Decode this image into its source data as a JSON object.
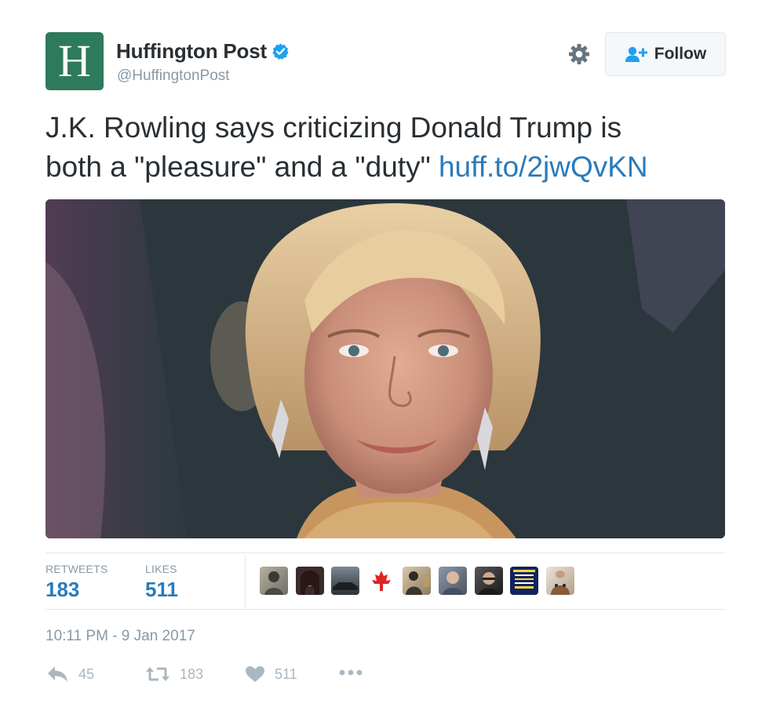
{
  "account": {
    "avatar_letter": "H",
    "display_name": "Huffington Post",
    "handle": "@HuffingtonPost",
    "verified": true,
    "brand_color": "#2d7a5c"
  },
  "header": {
    "follow_label": "Follow",
    "settings_icon": "gear-icon",
    "follow_icon": "add-user-icon"
  },
  "tweet": {
    "text_line1": "J.K. Rowling says criticizing Donald Trump is",
    "text_line2": "both a \"pleasure\" and a \"duty\"",
    "link": "huff.to/2jwQvKN",
    "link_color": "#2b7bb9"
  },
  "stats": {
    "retweets_label": "RETWEETS",
    "retweets_count": "183",
    "likes_label": "LIKES",
    "likes_count": "511",
    "liker_avatars": [
      "avatar-1",
      "avatar-2",
      "avatar-3",
      "avatar-canada-flag",
      "avatar-5",
      "avatar-6",
      "avatar-7",
      "avatar-8",
      "avatar-9"
    ]
  },
  "meta": {
    "timestamp": "10:11 PM - 9 Jan 2017"
  },
  "actions": {
    "reply_count": "45",
    "retweet_count": "183",
    "like_count": "511",
    "reply_icon": "reply-icon",
    "retweet_icon": "retweet-icon",
    "like_icon": "heart-icon",
    "more_icon": "more-icon"
  }
}
